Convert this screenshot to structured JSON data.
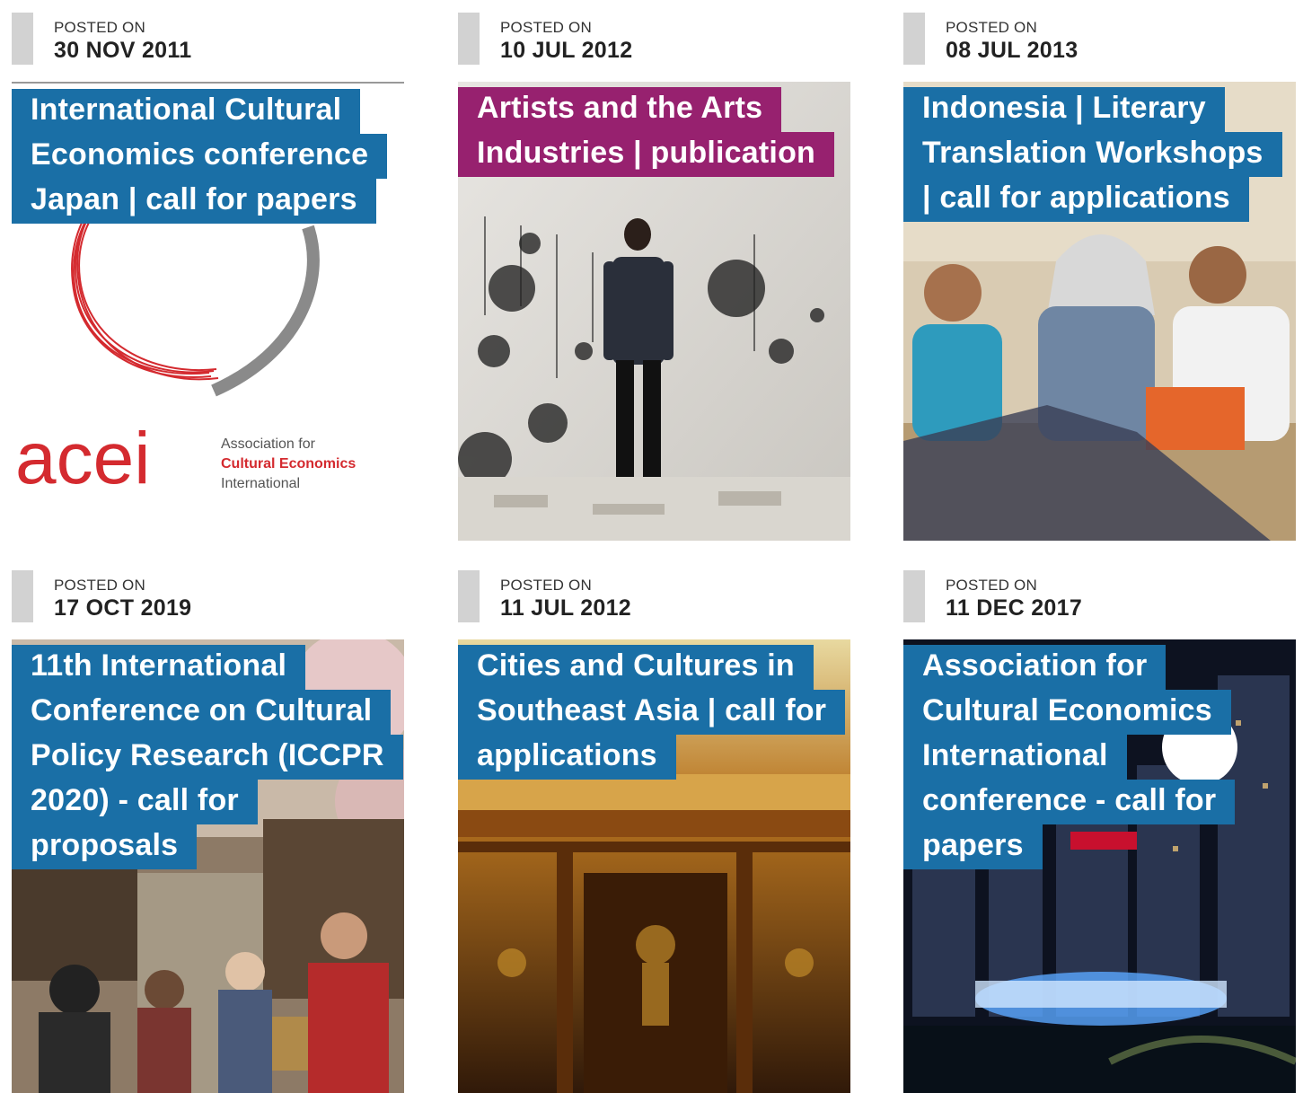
{
  "posted_label": "POSTED ON",
  "cards": [
    {
      "date": "30 NOV 2011",
      "title_lines": [
        "International Cultural",
        "Economics conference",
        "Japan | call for papers"
      ],
      "title_color": "#1a6fa6",
      "logo": {
        "mark": "acei",
        "line1": "Association for",
        "line2": "Cultural Economics",
        "line3": "International"
      }
    },
    {
      "date": "10 JUL 2012",
      "title_lines": [
        "Artists and the Arts",
        "Industries | publication"
      ],
      "title_color": "#97216f"
    },
    {
      "date": "08 JUL 2013",
      "title_lines": [
        "Indonesia | Literary",
        "Translation Workshops",
        "| call for applications"
      ],
      "title_color": "#1a6fa6"
    },
    {
      "date": "17 OCT 2019",
      "title_lines": [
        "11th International",
        "Conference on Cultural",
        "Policy Research (ICCPR",
        "2020) - call for",
        "proposals"
      ],
      "title_color": "#1a6fa6"
    },
    {
      "date": "11 JUL 2012",
      "title_lines": [
        "Cities and Cultures in",
        "Southeast Asia | call for",
        "applications"
      ],
      "title_color": "#1a6fa6"
    },
    {
      "date": "11 DEC 2017",
      "title_lines": [
        "Association for",
        "Cultural Economics",
        "International",
        "conference - call for",
        "papers"
      ],
      "title_color": "#1a6fa6"
    }
  ]
}
